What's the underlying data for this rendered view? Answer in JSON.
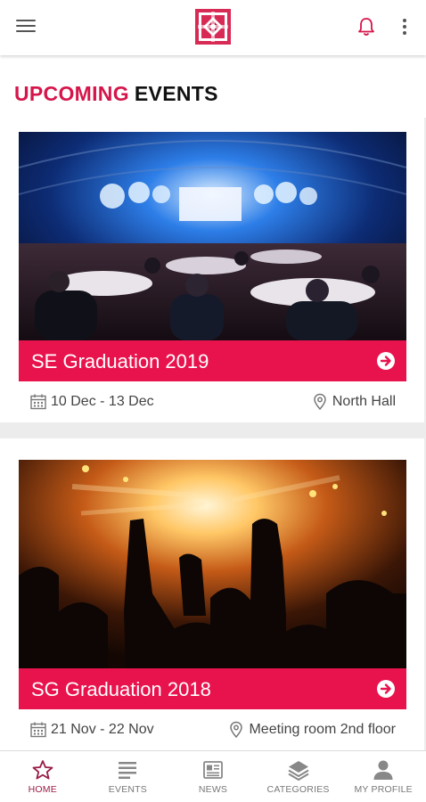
{
  "app": {
    "icons": {
      "menu": "menu-icon",
      "logo": "app-logo",
      "notifications": "bell-icon",
      "more": "more-vert-icon"
    }
  },
  "page": {
    "title_highlight": "UPCOMING",
    "title_rest": "EVENTS"
  },
  "colors": {
    "accent": "#e8134d",
    "title_highlight": "#d5164b",
    "active_tab": "#9b1c46"
  },
  "events": [
    {
      "title": "SE Graduation 2019",
      "date": "10 Dec - 13 Dec",
      "location": "North Hall",
      "image": "banquet-hall-photo"
    },
    {
      "title": "SG Graduation 2018",
      "date": "21 Nov - 22 Nov",
      "location": "Meeting room 2nd floor",
      "image": "concert-crowd-photo"
    }
  ],
  "nav": {
    "active": "home",
    "items": [
      {
        "label": "HOME",
        "icon": "star-icon"
      },
      {
        "label": "EVENTS",
        "icon": "list-icon"
      },
      {
        "label": "NEWS",
        "icon": "newspaper-icon"
      },
      {
        "label": "CATEGORIES",
        "icon": "layers-icon"
      },
      {
        "label": "MY PROFILE",
        "icon": "person-icon"
      }
    ]
  }
}
